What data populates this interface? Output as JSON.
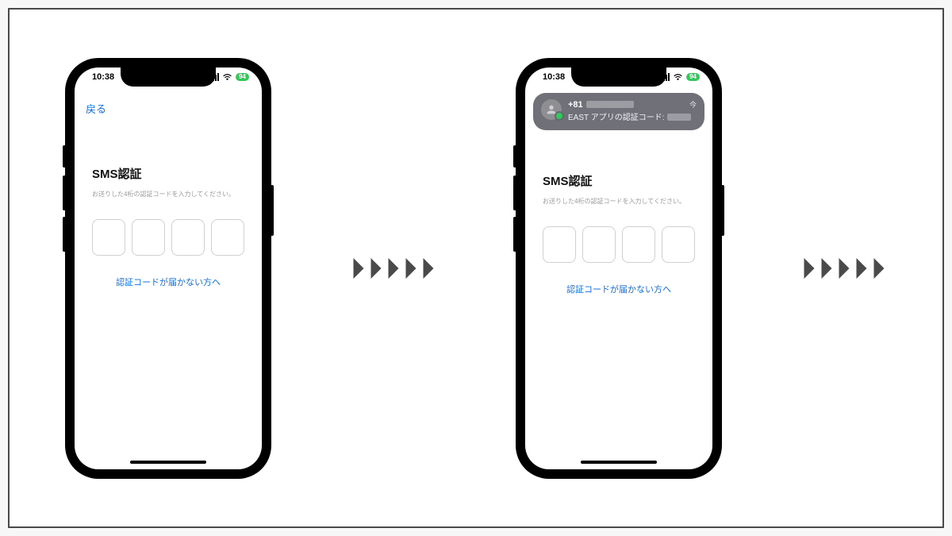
{
  "status": {
    "time": "10:38",
    "battery": "94"
  },
  "screen": {
    "back_label": "戻る",
    "title": "SMS認証",
    "subtitle": "お送りした4桁の認証コードを入力してください。",
    "help_link": "認証コードが届かない方へ"
  },
  "notification": {
    "sender": "+81",
    "time_label": "今",
    "message": "EAST アプリの認証コード:"
  }
}
